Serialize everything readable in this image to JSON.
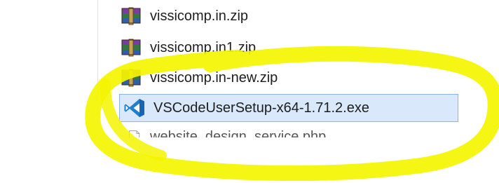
{
  "files": [
    {
      "name": "vissicomp.in.zip",
      "icon": "winrar-archive-icon"
    },
    {
      "name": "vissicomp.in1.zip",
      "icon": "winrar-archive-icon"
    },
    {
      "name": "vissicomp.in-new.zip",
      "icon": "winrar-archive-icon"
    },
    {
      "name": "VSCodeUserSetup-x64-1.71.2.exe",
      "icon": "vscode-icon",
      "selected": true
    },
    {
      "name": "website_design_service.php",
      "icon": "php-file-icon",
      "partial": true
    }
  ],
  "colors": {
    "highlight": "#f5f500",
    "selection_bg": "#d9e8fa",
    "selection_border": "#8bb5e6"
  }
}
